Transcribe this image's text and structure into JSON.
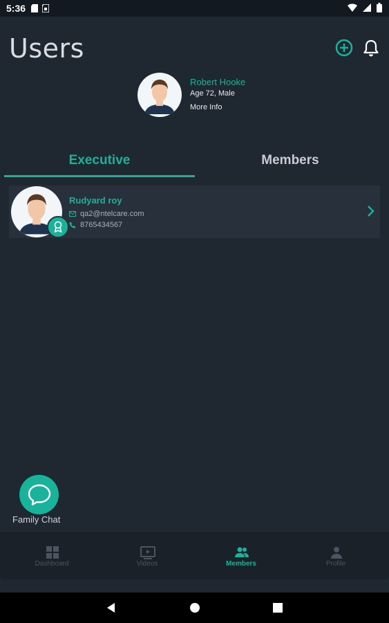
{
  "status_bar": {
    "time": "5:36",
    "left_icons": [
      "sd-card-icon",
      "sim-icon"
    ],
    "right_icons": [
      "wifi-icon",
      "signal-icon",
      "battery-icon"
    ]
  },
  "header": {
    "title": "Users",
    "actions": [
      "add-circle-icon",
      "bell-icon"
    ]
  },
  "current_user": {
    "name": "Robert Hooke",
    "details": "Age 72, Male",
    "more_link": "More Info"
  },
  "tabs": [
    {
      "label": "Executive",
      "active": true
    },
    {
      "label": "Members",
      "active": false
    }
  ],
  "members": [
    {
      "name": "Rudyard roy",
      "email": "qa2@ntelcare.com",
      "phone": "8765434567",
      "badge": "award-icon"
    }
  ],
  "fab": {
    "label": "Family Chat",
    "icon": "chat-bubble-icon"
  },
  "bottom_nav": [
    {
      "label": "Dashboard",
      "icon": "dashboard-icon",
      "active": false
    },
    {
      "label": "Videos",
      "icon": "video-icon",
      "active": false
    },
    {
      "label": "Members",
      "icon": "group-icon",
      "active": true
    },
    {
      "label": "Profile",
      "icon": "person-icon",
      "active": false
    }
  ],
  "colors": {
    "accent": "#19b39b",
    "background": "#1f2730",
    "card": "#28313b",
    "nav": "#1a2128"
  }
}
